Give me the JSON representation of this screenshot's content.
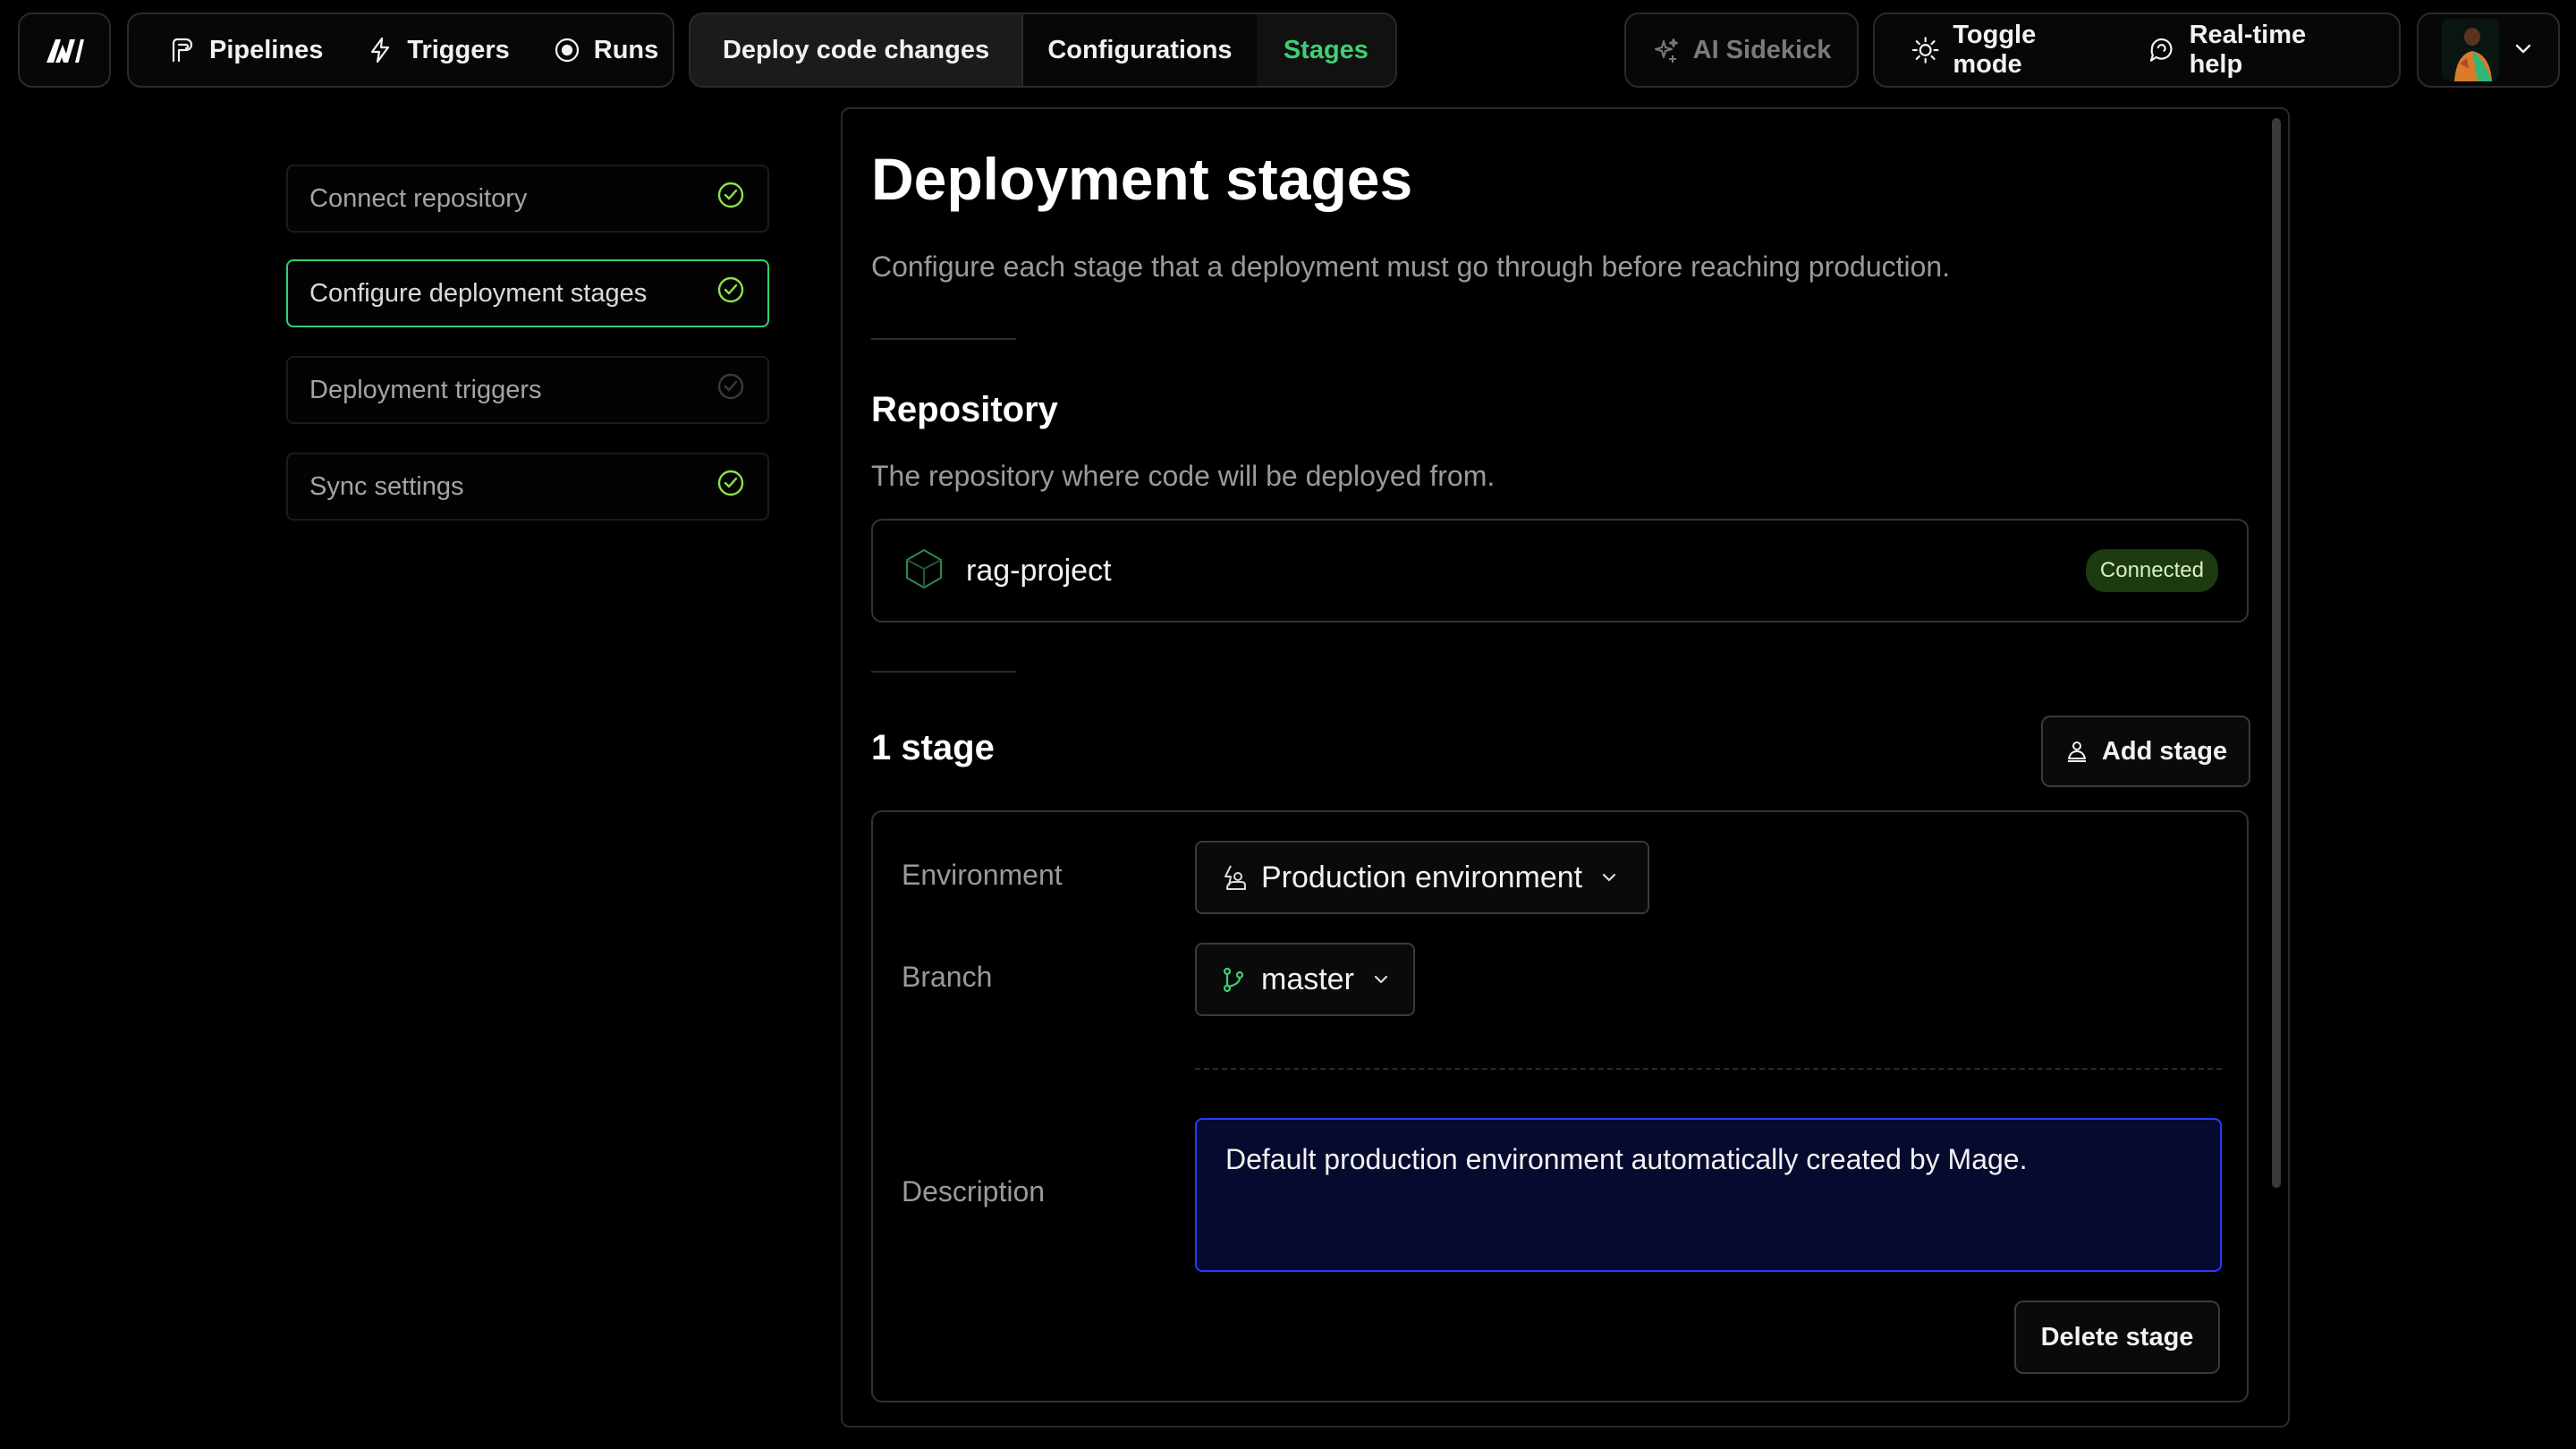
{
  "colors": {
    "accent_green": "#2ed471",
    "stages_tab_text": "#3ecf74",
    "description_border": "#2b3bff",
    "badge_bg": "#1d3a10"
  },
  "topbar": {
    "logo_icon": "mage-logo-icon",
    "nav": [
      {
        "label": "Pipelines",
        "icon": "pipelines-icon"
      },
      {
        "label": "Triggers",
        "icon": "lightning-icon"
      },
      {
        "label": "Runs",
        "icon": "target-icon"
      }
    ],
    "deploy_tabs": [
      {
        "label": "Deploy code changes"
      },
      {
        "label": "Configurations"
      },
      {
        "label": "Stages"
      }
    ],
    "ai_sidekick": "AI Sidekick",
    "toggle_mode": "Toggle mode",
    "realtime_help": "Real-time help"
  },
  "sidebar": {
    "steps": [
      {
        "label": "Connect repository",
        "status": "complete"
      },
      {
        "label": "Configure deployment stages",
        "status": "complete"
      },
      {
        "label": "Deployment triggers",
        "status": "pending"
      },
      {
        "label": "Sync settings",
        "status": "complete"
      }
    ]
  },
  "main": {
    "title": "Deployment stages",
    "subtitle": "Configure each stage that a deployment must go through before reaching production.",
    "repository": {
      "heading": "Repository",
      "subheading": "The repository where code will be deployed from.",
      "name": "rag-project",
      "badge": "Connected"
    },
    "stages": {
      "count_label": "1 stage",
      "add_button": "Add stage",
      "stage": {
        "environment_label": "Environment",
        "environment_value": "Production environment",
        "branch_label": "Branch",
        "branch_value": "master",
        "description_label": "Description",
        "description_value": "Default production environment automatically created by Mage.",
        "delete_button": "Delete stage"
      }
    }
  }
}
